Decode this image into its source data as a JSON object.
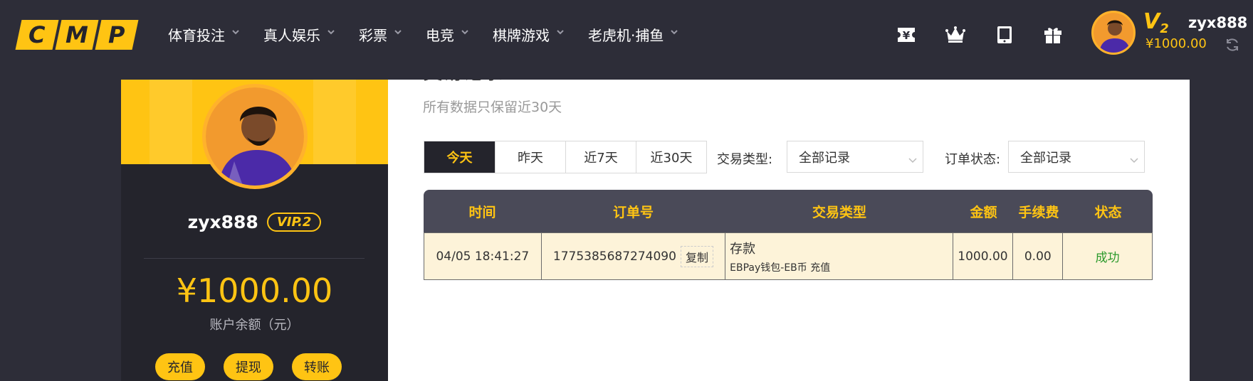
{
  "logo": {
    "letters": [
      "C",
      "M",
      "P"
    ]
  },
  "nav": [
    {
      "label": "体育投注"
    },
    {
      "label": "真人娱乐"
    },
    {
      "label": "彩票"
    },
    {
      "label": "电竞"
    },
    {
      "label": "棋牌游戏"
    },
    {
      "label": "老虎机·捕鱼"
    }
  ],
  "topbar": {
    "icons": [
      "currency-icon",
      "crown-icon",
      "tablet-icon",
      "gift-icon"
    ],
    "vip_letter": "V",
    "vip_level": "2",
    "username": "zyx888",
    "balance": "¥1000.00"
  },
  "profile": {
    "username": "zyx888",
    "vip_label": "VIP.2",
    "amount": "¥1000.00",
    "amount_label": "账户余额（元）",
    "actions": [
      "充值",
      "提现",
      "转账"
    ]
  },
  "main": {
    "heading": "交易记录",
    "note": "所有数据只保留近30天",
    "date_tabs": [
      "今天",
      "昨天",
      "近7天",
      "近30天"
    ],
    "active_tab": 0,
    "filters": {
      "type_label": "交易类型:",
      "type_value": "全部记录",
      "status_label": "订单状态:",
      "status_value": "全部记录"
    },
    "table": {
      "headers": [
        "时间",
        "订单号",
        "交易类型",
        "金额",
        "手续费",
        "状态"
      ],
      "rows": [
        {
          "time": "04/05 18:41:27",
          "order": "1775385687274090",
          "copy": "复制",
          "type_main": "存款",
          "type_sub": "EBPay钱包-EB币 充值",
          "amount": "1000.00",
          "fee": "0.00",
          "status": "成功"
        }
      ]
    }
  },
  "colors": {
    "accent": "#ffc413",
    "dark": "#24242c",
    "success": "#2c9a2c",
    "row_bg": "#fdf3d9"
  }
}
